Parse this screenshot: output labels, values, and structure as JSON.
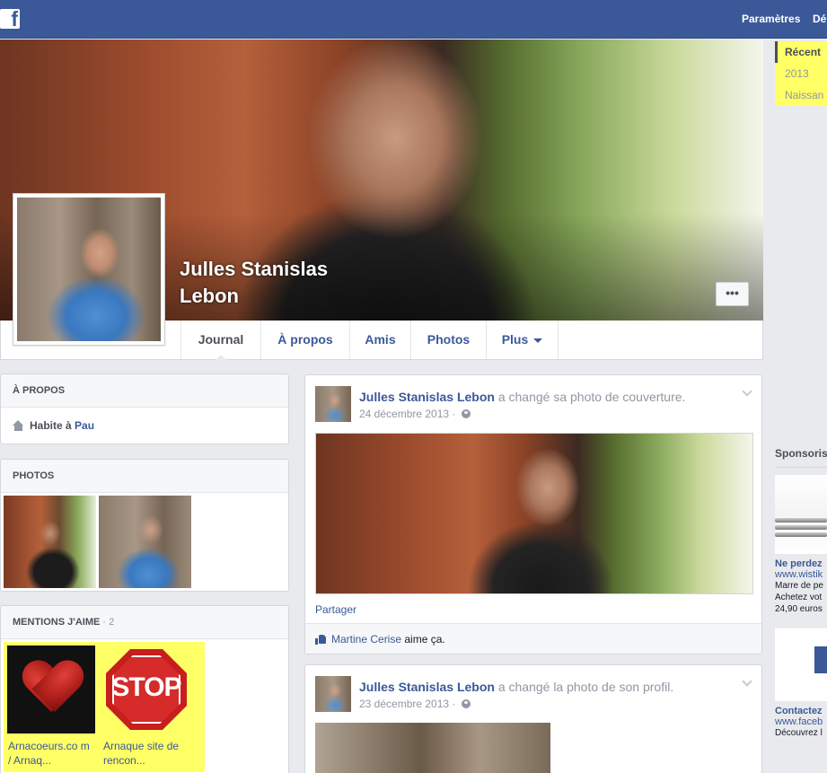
{
  "topbar": {
    "logo": "f",
    "links": [
      "Paramètres",
      "Dé"
    ]
  },
  "profile": {
    "name": "Julles Stanislas Lebon",
    "cover_more": "•••"
  },
  "timeline_nav": {
    "tabs": [
      {
        "label": "Journal",
        "active": true
      },
      {
        "label": "À propos",
        "active": false
      },
      {
        "label": "Amis",
        "active": false
      },
      {
        "label": "Photos",
        "active": false
      },
      {
        "label": "Plus",
        "active": false
      }
    ]
  },
  "scrubber": {
    "items": [
      "Récent",
      "2013",
      "Naissan"
    ],
    "highlight_color": "#ffff66"
  },
  "about": {
    "title": "À PROPOS",
    "lives_prefix": "Habite à ",
    "lives_city": "Pau"
  },
  "photos": {
    "title": "PHOTOS"
  },
  "likes": {
    "title": "MENTIONS J'AIME",
    "count": "2",
    "pages": [
      {
        "label": "Arnacoeurs.co m / Arnaq..."
      },
      {
        "label": "Arnaque site de rencon..."
      }
    ],
    "stop_text": "STOP"
  },
  "posts": [
    {
      "author": "Julles Stanislas Lebon",
      "action": " a changé sa photo de couverture.",
      "date": "24 décembre 2013 · ",
      "share": "Partager",
      "liker": "Martine Cerise",
      "liker_suffix": " aime ça."
    },
    {
      "author": "Julles Stanislas Lebon",
      "action": " a changé la photo de son profil.",
      "date": "23 décembre 2013 · "
    }
  ],
  "sponsored": {
    "title": "Sponsorisé",
    "ad1": {
      "headline": "Ne perdez",
      "url": "www.wistik",
      "lines": [
        "Marre de pe",
        "Achetez vot",
        "24,90 euros"
      ]
    },
    "ad2": {
      "headline": "Contactez",
      "url": "www.faceb",
      "lines": [
        "Découvrez l"
      ]
    }
  },
  "colors": {
    "brand_blue": "#3b5998",
    "page_bg": "#e9eaed",
    "highlight": "#ffff66"
  }
}
